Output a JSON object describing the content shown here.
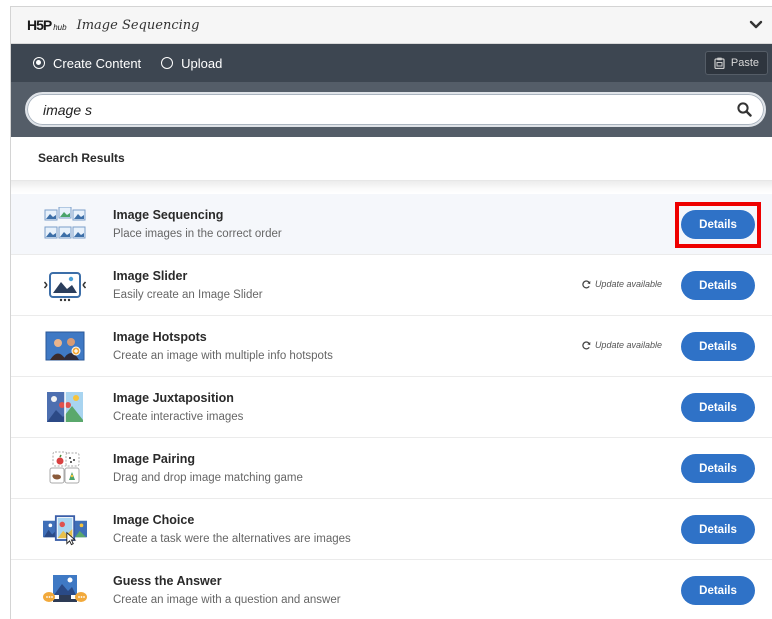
{
  "hub": {
    "logo_main": "H5P",
    "logo_sub": "hub",
    "title": "Image Sequencing"
  },
  "tabs": {
    "create": "Create Content",
    "upload": "Upload",
    "selected": "create"
  },
  "paste_label": "Paste",
  "search": {
    "value": "image s"
  },
  "results_heading": "Search Results",
  "update_label": "Update available",
  "details_label": "Details",
  "items": [
    {
      "name": "Image Sequencing",
      "desc": "Place images in the correct order",
      "icon": "image-sequencing-icon",
      "update": false,
      "selected": true
    },
    {
      "name": "Image Slider",
      "desc": "Easily create an Image Slider",
      "icon": "image-slider-icon",
      "update": true,
      "selected": false
    },
    {
      "name": "Image Hotspots",
      "desc": "Create an image with multiple info hotspots",
      "icon": "image-hotspots-icon",
      "update": true,
      "selected": false
    },
    {
      "name": "Image Juxtaposition",
      "desc": "Create interactive images",
      "icon": "image-juxtaposition-icon",
      "update": false,
      "selected": false
    },
    {
      "name": "Image Pairing",
      "desc": "Drag and drop image matching game",
      "icon": "image-pairing-icon",
      "update": false,
      "selected": false
    },
    {
      "name": "Image Choice",
      "desc": "Create a task were the alternatives are images",
      "icon": "image-choice-icon",
      "update": false,
      "selected": false
    },
    {
      "name": "Guess the Answer",
      "desc": "Create an image with a question and answer",
      "icon": "guess-the-answer-icon",
      "update": false,
      "selected": false
    }
  ],
  "colors": {
    "accent": "#2f72c7",
    "tabbar": "#3d4651",
    "search_bg": "#545d68",
    "highlight": "#ee0000"
  }
}
